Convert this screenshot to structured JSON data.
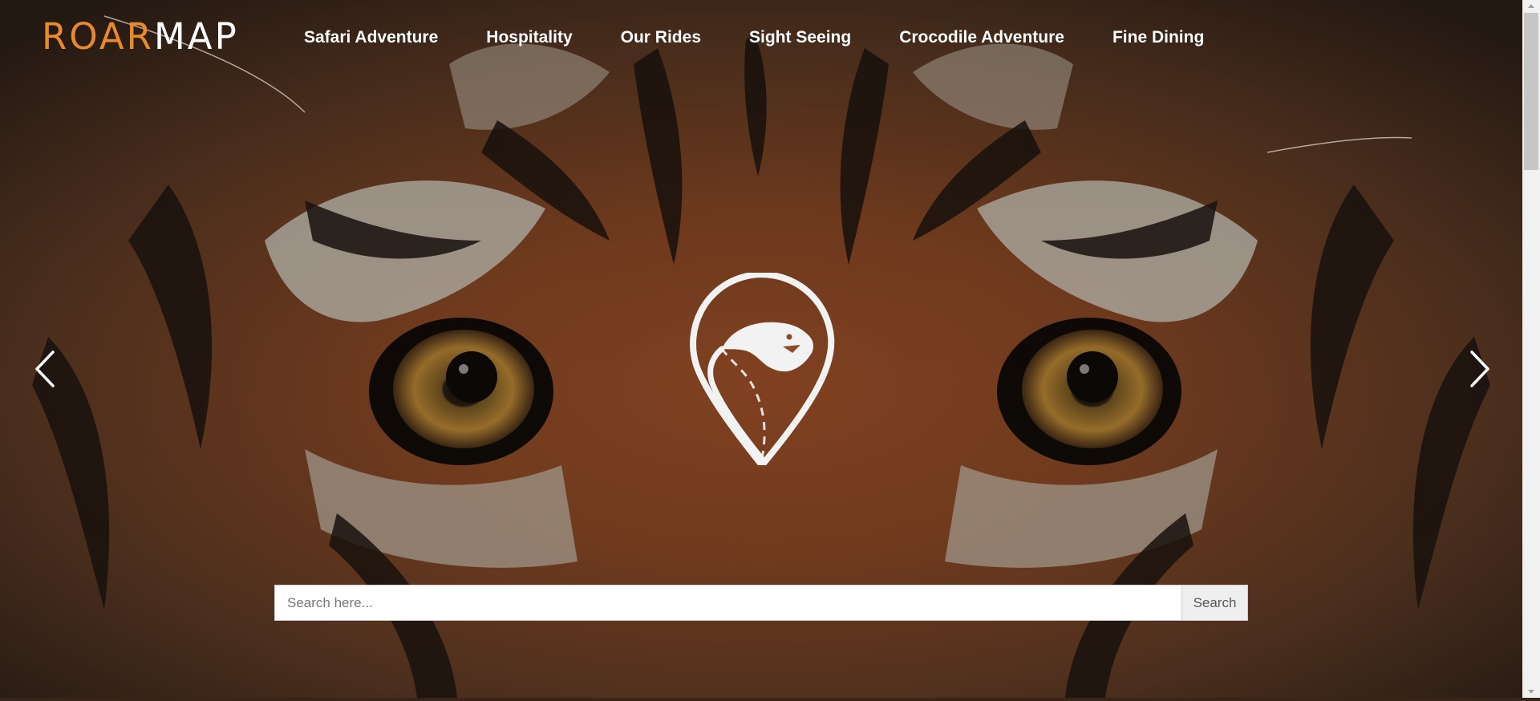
{
  "brand": {
    "logo_part1": "ROAR",
    "logo_part2": "MAP",
    "accent_color": "#e8892c"
  },
  "nav": {
    "items": [
      {
        "label": "Safari Adventure"
      },
      {
        "label": "Hospitality"
      },
      {
        "label": "Our Rides"
      },
      {
        "label": "Sight Seeing"
      },
      {
        "label": "Crocodile Adventure"
      },
      {
        "label": "Fine Dining"
      }
    ]
  },
  "carousel": {
    "prev_icon": "chevron-left-icon",
    "next_icon": "chevron-right-icon"
  },
  "hero": {
    "logo_icon": "map-pin-tiger-icon"
  },
  "search": {
    "placeholder": "Search here...",
    "value": "",
    "button_label": "Search"
  }
}
